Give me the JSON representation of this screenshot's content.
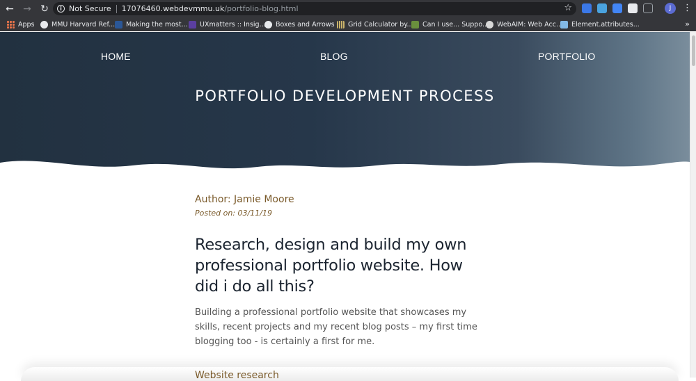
{
  "browser": {
    "url_security": "Not Secure",
    "url_host": "17076460.webdevmmu.uk",
    "url_path": "/portfolio-blog.html",
    "profile_initial": "J",
    "bookmarks": [
      {
        "label": "Apps",
        "icon": "apps-grid-icon"
      },
      {
        "label": "MMU Harvard Ref...",
        "icon": "globe-icon"
      },
      {
        "label": "Making the most...",
        "icon": "word-doc-icon"
      },
      {
        "label": "UXmatters :: Insig...",
        "icon": "uxmatters-icon"
      },
      {
        "label": "Boxes and Arrows -",
        "icon": "globe-icon"
      },
      {
        "label": "Grid Calculator by...",
        "icon": "grid-calculator-icon"
      },
      {
        "label": "Can I use... Suppo...",
        "icon": "caniuse-icon"
      },
      {
        "label": "WebAIM: Web Acc...",
        "icon": "webaim-icon"
      },
      {
        "label": "Element.attributes...",
        "icon": "mdn-icon"
      }
    ],
    "more_bookmarks": "»"
  },
  "nav": {
    "home": "HOME",
    "blog": "BLOG",
    "portfolio": "PORTFOLIO"
  },
  "hero": {
    "title": "PORTFOLIO DEVELOPMENT PROCESS"
  },
  "article": {
    "author": "Author: Jamie Moore",
    "posted": "Posted on: 03/11/19",
    "headline": "Research, design and build my own professional portfolio website. How did i do all this?",
    "intro": "Building a professional portfolio website that showcases my skills, recent projects and my recent blog posts – my first time blogging too - is certainly a first for me.",
    "subheading": "Website research"
  },
  "colors": {
    "hero_dark": "#223140",
    "hero_light": "#7a8d9c",
    "accent_brown": "#7a5a2a",
    "headline": "#1b2430"
  }
}
